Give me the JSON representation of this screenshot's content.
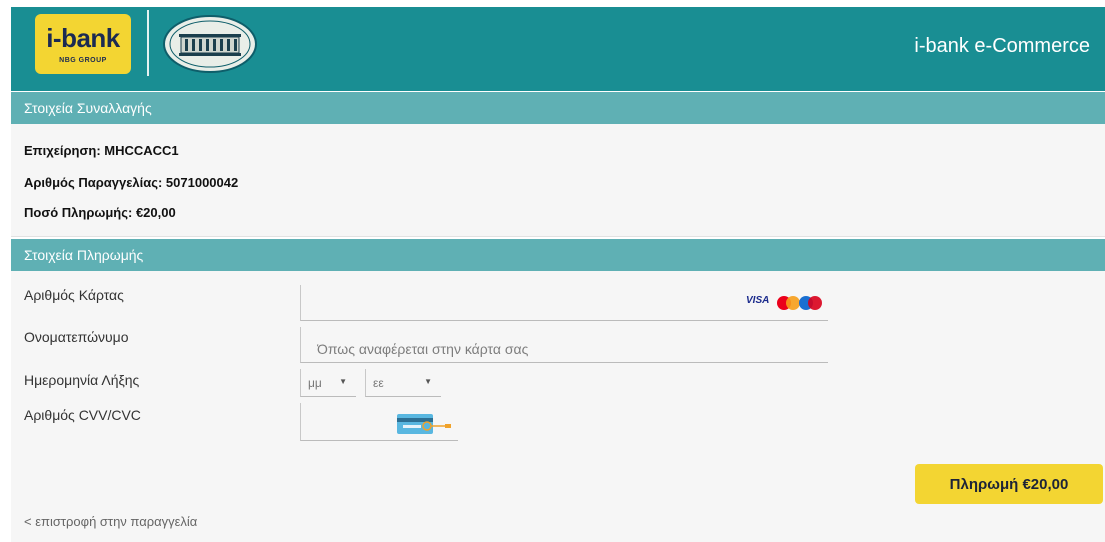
{
  "header": {
    "logo_brand": "i-bank",
    "logo_group": "NBG GROUP",
    "title": "i-bank e-Commerce",
    "emblem_icon": "nbg-building-icon"
  },
  "transaction": {
    "section_title": "Στοιχεία Συναλλαγής",
    "merchant": "Επιχείρηση: MHCCACC1",
    "order_number": "Αριθμός Παραγγελίας: 5071000042",
    "amount": "Ποσό Πληρωμής: €20,00"
  },
  "payment": {
    "section_title": "Στοιχεία Πληρωμής",
    "card_number_label": "Αριθμός Κάρτας",
    "card_number_value": "",
    "card_brands": "VISA",
    "cardholder_label": "Ονοματεπώνυμο",
    "cardholder_placeholder": "Όπως αναφέρεται στην κάρτα σας",
    "cardholder_value": "",
    "expiry_label": "Ημερομηνία Λήξης",
    "expiry_month": "μμ",
    "expiry_year": "εε",
    "cvv_label": "Αριθμός CVV/CVC",
    "cvv_value": "",
    "pay_button": "Πληρωμή €20,00",
    "back_link": "< επιστροφή στην παραγγελία"
  },
  "colors": {
    "header_bg": "#198e93",
    "section_bar": "#5fb0b4",
    "button_bg": "#f3d532"
  }
}
